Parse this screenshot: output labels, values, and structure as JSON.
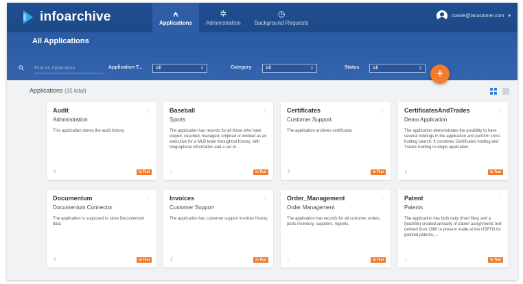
{
  "brand": {
    "name": "infoarchive"
  },
  "nav": [
    {
      "label": "Applications",
      "icon": "applications-icon",
      "active": true
    },
    {
      "label": "Administration",
      "icon": "gear-icon",
      "active": false
    },
    {
      "label": "Background Requests",
      "icon": "clock-icon",
      "active": false
    }
  ],
  "user": {
    "email": "connie@iacustomer.com",
    "menu_icon": "chevron-down-icon"
  },
  "page": {
    "title": "All Applications"
  },
  "filters": {
    "search_placeholder": "Find an Application",
    "application_type": {
      "label": "Application T...",
      "value": "All"
    },
    "category": {
      "label": "Category",
      "value": "All"
    },
    "status": {
      "label": "Status",
      "value": "All"
    }
  },
  "fab": {
    "label": "+"
  },
  "list": {
    "heading": "Applications",
    "count": "(15 total)"
  },
  "cards": [
    {
      "title": "Audit",
      "subtitle": "Administration",
      "desc": "This application stores the audit history",
      "badge": "In Test",
      "icon": "key-icon"
    },
    {
      "title": "Baseball",
      "subtitle": "Sports",
      "desc": "The application has records for all those who have played, coached, managed, umpired or worked as an executive for a MLB team throughout history, with biographical information and a set of…",
      "badge": "In Test",
      "icon": "circle-icon"
    },
    {
      "title": "Certificates",
      "subtitle": "Customer Support",
      "desc": "The application archives certificates",
      "badge": "In Test",
      "icon": "key-icon"
    },
    {
      "title": "CertificatesAndTrades",
      "subtitle": "Demo Application",
      "desc": "The application demonstrates the posibility to have several holdings in the application and perform cross holding search. It combines Certificates holding and Trades holding in single application.",
      "badge": "In Test",
      "icon": "key-icon"
    },
    {
      "title": "Documentum",
      "subtitle": "Documentum Connector",
      "desc": "The application is supposed to store Documentum data",
      "badge": "In Test",
      "icon": "key-icon"
    },
    {
      "title": "Invoices",
      "subtitle": "Customer Support",
      "desc": "The application has customer support invoices history",
      "badge": "In Test",
      "icon": "key-icon"
    },
    {
      "title": "Order_Management",
      "subtitle": "Order Management",
      "desc": "The application has records for all customer orders, parts inventory, suppliers, regions.",
      "badge": "In Test",
      "icon": "circle-icon"
    },
    {
      "title": "Patent",
      "subtitle": "Patents",
      "desc": "The application has both daily (front files) and a (backfile) created annually of patent assignments text derived from 1980 to present made at the USPTO for granted patents,…",
      "badge": "In Test",
      "icon": "circle-icon"
    }
  ],
  "colors": {
    "header": "#1e4a89",
    "subheader": "#3464ad",
    "accent": "#f07c2c",
    "background": "#f1f2f4"
  }
}
